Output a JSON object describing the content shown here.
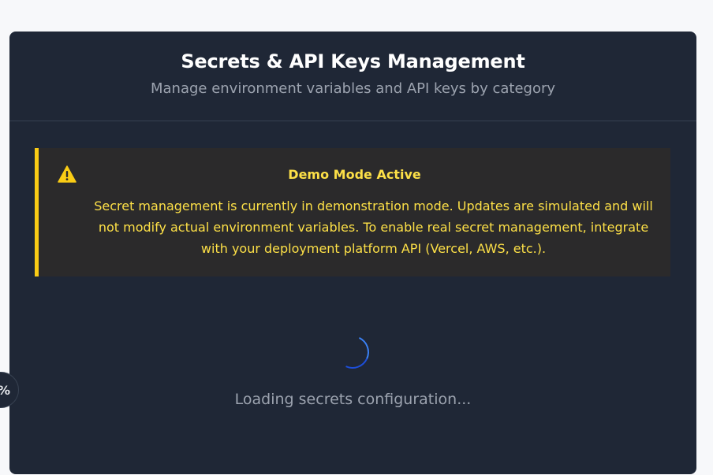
{
  "header": {
    "title": "Secrets & API Keys Management",
    "subtitle": "Manage environment variables and API keys by category"
  },
  "notice": {
    "icon": "warning-triangle-icon",
    "title": "Demo Mode Active",
    "message": "Secret management is currently in demonstration mode. Updates are simulated and will not modify actual environment variables. To enable real secret management, integrate with your deployment platform API (Vercel, AWS, etc.).",
    "accent_color": "#facc15"
  },
  "loading": {
    "icon": "spinner-icon",
    "text": "Loading secrets configuration..."
  },
  "side_widget": {
    "icon": "percent-icon",
    "glyph": "%"
  },
  "colors": {
    "panel_bg": "#1f2736",
    "page_bg": "#f7f8fa",
    "spinner": "#3b82f6"
  }
}
